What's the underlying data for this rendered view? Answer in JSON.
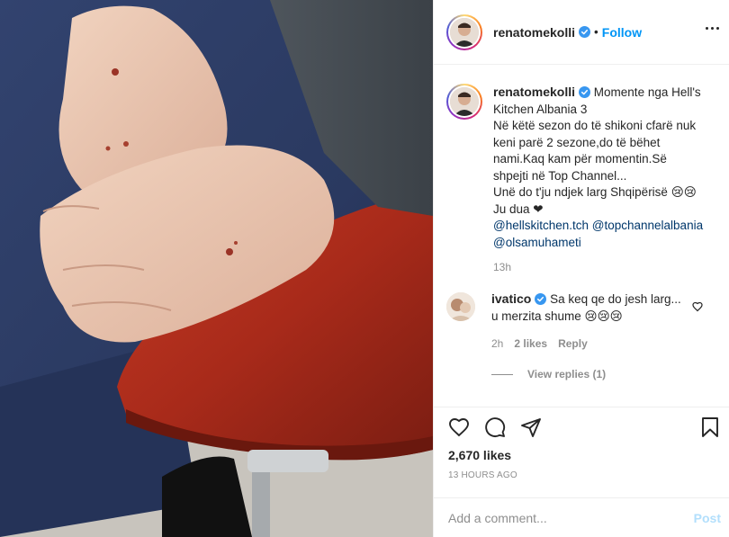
{
  "post": {
    "image_alt": "Photo of scarred hands resting on trousers, red chair seat",
    "author": "renatomekolli",
    "follow_label": "Follow",
    "separator": "•",
    "caption": {
      "author": "renatomekolli",
      "lines": [
        "Momente nga Hell's",
        "Kitchen Albania 3",
        "Në këtë sezon do të shikoni cfarë nuk",
        "keni parë 2 sezone,do të bëhet",
        "nami.Kaq kam për momentin.Së",
        "shpejti në Top Channel...",
        "Unë do t'ju ndjek larg Shqipërisë 😢😢",
        "Ju dua ❤"
      ],
      "mentions": [
        "@hellskitchen.tch",
        "@topchannelalbania",
        "@olsamuhameti"
      ],
      "time": "13h"
    },
    "comment": {
      "author": "ivatico",
      "text_line1": "Sa keq qe do jesh larg...",
      "text_line2": "u merzita shume 😢😢😢",
      "time": "2h",
      "likes": "2 likes",
      "reply": "Reply",
      "view_replies": "View replies (1)"
    },
    "likes": "2,670 likes",
    "posted_ago": "13 HOURS AGO",
    "add_comment_placeholder": "Add a comment...",
    "post_label": "Post"
  },
  "icons": {
    "like": "heart-icon",
    "comment": "comment-icon",
    "share": "paper-plane-icon",
    "save": "bookmark-icon",
    "more": "more-options-icon",
    "verified": "verified-badge-icon"
  },
  "colors": {
    "accent": "#0095f6",
    "mention": "#00376b",
    "muted": "#8e8e8e",
    "post_disabled": "#b2dffc",
    "chair_red": "#b5301f",
    "trousers_blue": "#2c3b66"
  }
}
